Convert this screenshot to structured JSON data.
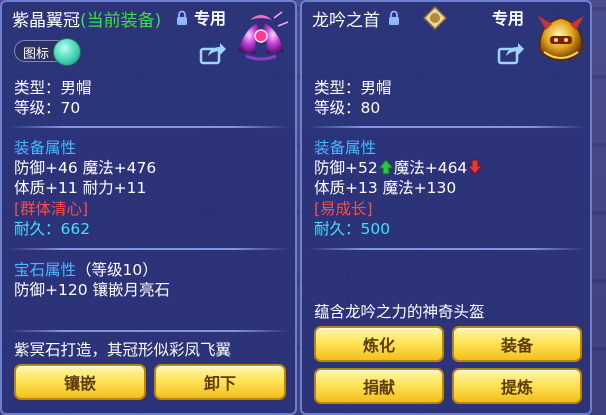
{
  "left": {
    "title_main": "紫晶翼冠",
    "title_suffix": "(当前装备)",
    "exclusive": "专用",
    "toggle_label": "图标",
    "type": "类型：男帽",
    "level": "等级：70",
    "attr_heading": "装备属性",
    "attr_line1": "防御+46 魔法+476",
    "attr_line2": "体质+11 耐力+11",
    "special": "[群体清心]",
    "durability": "耐久：662",
    "gem_heading": "宝石属性",
    "gem_level": "（等级10）",
    "gem_line": "防御+120 镶嵌月亮石",
    "description": "紫冥石打造，其冠形似彩凤飞翼",
    "btn_inlay": "镶嵌",
    "btn_unequip": "卸下"
  },
  "right": {
    "title": "龙吟之首",
    "exclusive": "专用",
    "type": "类型：男帽",
    "level": "等级：80",
    "attr_heading": "装备属性",
    "defense": "防御+52",
    "magic": "魔法+464",
    "attr_line2": "体质+13 魔法+130",
    "special": "[易成长]",
    "durability": "耐久：500",
    "description": "蕴含龙吟之力的神奇头盔",
    "btn_refine": "炼化",
    "btn_equip": "装备",
    "btn_donate": "捐献",
    "btn_extract": "提炼"
  },
  "colors": {
    "panel_bg": "#2a3278",
    "heading": "#49b6ff",
    "special": "#ff4a4a",
    "durability": "#42e0ff",
    "current_equip": "#3dde46",
    "button_gold": "#ffe45a"
  },
  "icons": {
    "left_item": "purple-wing-crown-icon",
    "right_item": "golden-dragon-helmet-icon",
    "badge": "equipment-badge-icon",
    "up": "arrow-up-icon",
    "down": "arrow-down-icon",
    "lock": "lock-icon",
    "share": "share-icon"
  }
}
